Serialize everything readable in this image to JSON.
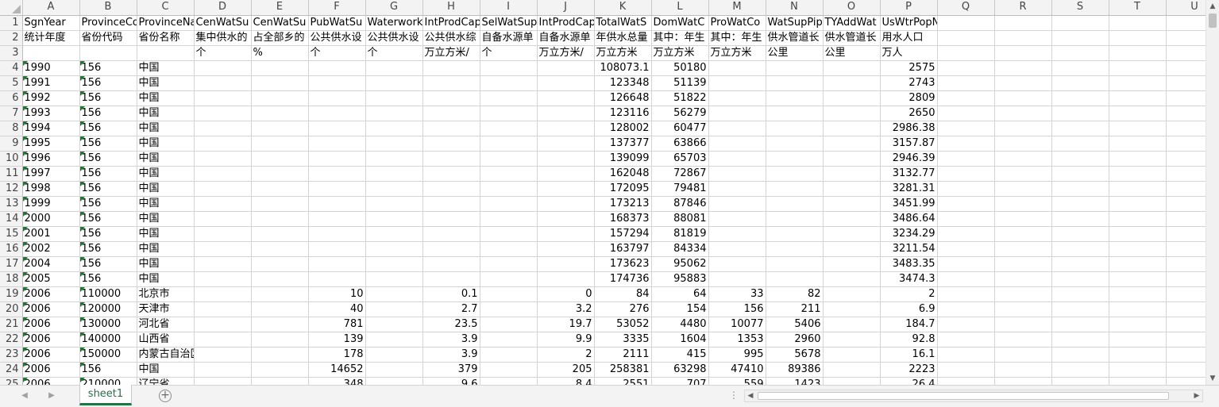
{
  "columns": [
    "A",
    "B",
    "C",
    "D",
    "E",
    "F",
    "G",
    "H",
    "I",
    "J",
    "K",
    "L",
    "M",
    "N",
    "O",
    "P",
    "Q",
    "R",
    "S",
    "T",
    "U"
  ],
  "rows": [
    {
      "n": "1",
      "cells": [
        "SgnYear",
        "ProvinceCo",
        "ProvinceNa",
        "CenWatSu",
        "CenWatSu",
        "PubWatSu",
        "Waterwork",
        "IntProdCap",
        "SelWatSup",
        "IntProdCap",
        "TotalWatS",
        "DomWatC",
        "ProWatCo",
        "WatSupPip",
        "TYAddWat",
        "UsWtrPopNum",
        "",
        "",
        "",
        "",
        ""
      ]
    },
    {
      "n": "2",
      "cells": [
        "统计年度",
        "省份代码",
        "省份名称",
        "集中供水的",
        "占全部乡的",
        "公共供水设",
        "公共供水设",
        "公共供水综",
        "自备水源单",
        "自备水源单",
        "年供水总量",
        "其中：年生",
        "其中：年生",
        "供水管道长",
        "供水管道长",
        "用水人口",
        "",
        "",
        "",
        "",
        ""
      ]
    },
    {
      "n": "3",
      "cells": [
        "",
        "",
        "",
        "个",
        "%",
        "个",
        "个",
        "万立方米/",
        "个",
        "万立方米/",
        "万立方米",
        "万立方米",
        "万立方米",
        "公里",
        "公里",
        "万人",
        "",
        "",
        "",
        "",
        ""
      ]
    },
    {
      "n": "4",
      "cells": [
        "1990",
        "156",
        "中国",
        "",
        "",
        "",
        "",
        "",
        "",
        "",
        "108073.1",
        "50180",
        "",
        "",
        "",
        "2575",
        "",
        "",
        "",
        "",
        ""
      ]
    },
    {
      "n": "5",
      "cells": [
        "1991",
        "156",
        "中国",
        "",
        "",
        "",
        "",
        "",
        "",
        "",
        "123348",
        "51139",
        "",
        "",
        "",
        "2743",
        "",
        "",
        "",
        "",
        ""
      ]
    },
    {
      "n": "6",
      "cells": [
        "1992",
        "156",
        "中国",
        "",
        "",
        "",
        "",
        "",
        "",
        "",
        "126648",
        "51822",
        "",
        "",
        "",
        "2809",
        "",
        "",
        "",
        "",
        ""
      ]
    },
    {
      "n": "7",
      "cells": [
        "1993",
        "156",
        "中国",
        "",
        "",
        "",
        "",
        "",
        "",
        "",
        "123116",
        "56279",
        "",
        "",
        "",
        "2650",
        "",
        "",
        "",
        "",
        ""
      ]
    },
    {
      "n": "8",
      "cells": [
        "1994",
        "156",
        "中国",
        "",
        "",
        "",
        "",
        "",
        "",
        "",
        "128002",
        "60477",
        "",
        "",
        "",
        "2986.38",
        "",
        "",
        "",
        "",
        ""
      ]
    },
    {
      "n": "9",
      "cells": [
        "1995",
        "156",
        "中国",
        "",
        "",
        "",
        "",
        "",
        "",
        "",
        "137377",
        "63866",
        "",
        "",
        "",
        "3157.87",
        "",
        "",
        "",
        "",
        ""
      ]
    },
    {
      "n": "10",
      "cells": [
        "1996",
        "156",
        "中国",
        "",
        "",
        "",
        "",
        "",
        "",
        "",
        "139099",
        "65703",
        "",
        "",
        "",
        "2946.39",
        "",
        "",
        "",
        "",
        ""
      ]
    },
    {
      "n": "11",
      "cells": [
        "1997",
        "156",
        "中国",
        "",
        "",
        "",
        "",
        "",
        "",
        "",
        "162048",
        "72867",
        "",
        "",
        "",
        "3132.77",
        "",
        "",
        "",
        "",
        ""
      ]
    },
    {
      "n": "12",
      "cells": [
        "1998",
        "156",
        "中国",
        "",
        "",
        "",
        "",
        "",
        "",
        "",
        "172095",
        "79481",
        "",
        "",
        "",
        "3281.31",
        "",
        "",
        "",
        "",
        ""
      ]
    },
    {
      "n": "13",
      "cells": [
        "1999",
        "156",
        "中国",
        "",
        "",
        "",
        "",
        "",
        "",
        "",
        "173213",
        "87846",
        "",
        "",
        "",
        "3451.99",
        "",
        "",
        "",
        "",
        ""
      ]
    },
    {
      "n": "14",
      "cells": [
        "2000",
        "156",
        "中国",
        "",
        "",
        "",
        "",
        "",
        "",
        "",
        "168373",
        "88081",
        "",
        "",
        "",
        "3486.64",
        "",
        "",
        "",
        "",
        ""
      ]
    },
    {
      "n": "15",
      "cells": [
        "2001",
        "156",
        "中国",
        "",
        "",
        "",
        "",
        "",
        "",
        "",
        "157294",
        "81819",
        "",
        "",
        "",
        "3234.29",
        "",
        "",
        "",
        "",
        ""
      ]
    },
    {
      "n": "16",
      "cells": [
        "2002",
        "156",
        "中国",
        "",
        "",
        "",
        "",
        "",
        "",
        "",
        "163797",
        "84334",
        "",
        "",
        "",
        "3211.54",
        "",
        "",
        "",
        "",
        ""
      ]
    },
    {
      "n": "17",
      "cells": [
        "2004",
        "156",
        "中国",
        "",
        "",
        "",
        "",
        "",
        "",
        "",
        "173623",
        "95062",
        "",
        "",
        "",
        "3483.35",
        "",
        "",
        "",
        "",
        ""
      ]
    },
    {
      "n": "18",
      "cells": [
        "2005",
        "156",
        "中国",
        "",
        "",
        "",
        "",
        "",
        "",
        "",
        "174736",
        "95883",
        "",
        "",
        "",
        "3474.3",
        "",
        "",
        "",
        "",
        ""
      ]
    },
    {
      "n": "19",
      "cells": [
        "2006",
        "110000",
        "北京市",
        "",
        "",
        "10",
        "",
        "0.1",
        "",
        "0",
        "84",
        "64",
        "33",
        "82",
        "",
        "2",
        "",
        "",
        "",
        "",
        ""
      ]
    },
    {
      "n": "20",
      "cells": [
        "2006",
        "120000",
        "天津市",
        "",
        "",
        "40",
        "",
        "2.7",
        "",
        "3.2",
        "276",
        "154",
        "156",
        "211",
        "",
        "6.9",
        "",
        "",
        "",
        "",
        ""
      ]
    },
    {
      "n": "21",
      "cells": [
        "2006",
        "130000",
        "河北省",
        "",
        "",
        "781",
        "",
        "23.5",
        "",
        "19.7",
        "53052",
        "4480",
        "10077",
        "5406",
        "",
        "184.7",
        "",
        "",
        "",
        "",
        ""
      ]
    },
    {
      "n": "22",
      "cells": [
        "2006",
        "140000",
        "山西省",
        "",
        "",
        "139",
        "",
        "3.9",
        "",
        "9.9",
        "3335",
        "1604",
        "1353",
        "2960",
        "",
        "92.8",
        "",
        "",
        "",
        "",
        ""
      ]
    },
    {
      "n": "23",
      "cells": [
        "2006",
        "150000",
        "内蒙古自治区",
        "",
        "",
        "178",
        "",
        "3.9",
        "",
        "2",
        "2111",
        "415",
        "995",
        "5678",
        "",
        "16.1",
        "",
        "",
        "",
        "",
        ""
      ]
    },
    {
      "n": "24",
      "cells": [
        "2006",
        "156",
        "中国",
        "",
        "",
        "14652",
        "",
        "379",
        "",
        "205",
        "258381",
        "63298",
        "47410",
        "89386",
        "",
        "2223",
        "",
        "",
        "",
        "",
        ""
      ]
    },
    {
      "n": "25",
      "cells": [
        "2006",
        "210000",
        "辽宁省",
        "",
        "",
        "348",
        "",
        "9.6",
        "",
        "8.4",
        "2551",
        "707",
        "559",
        "1423",
        "",
        "26.4",
        "",
        "",
        "",
        "",
        ""
      ]
    }
  ],
  "sheet_tab": "sheet1",
  "add_sheet_icon": "+",
  "split_dots": "⋮",
  "scroll_icons": {
    "up": "▲",
    "down": "▼",
    "left": "◀",
    "right": "▶"
  },
  "colors": {
    "accent": "#217346",
    "flag": "#1e7b34",
    "header_bg": "#f3f3f3",
    "gridline": "#d4d4d4"
  }
}
